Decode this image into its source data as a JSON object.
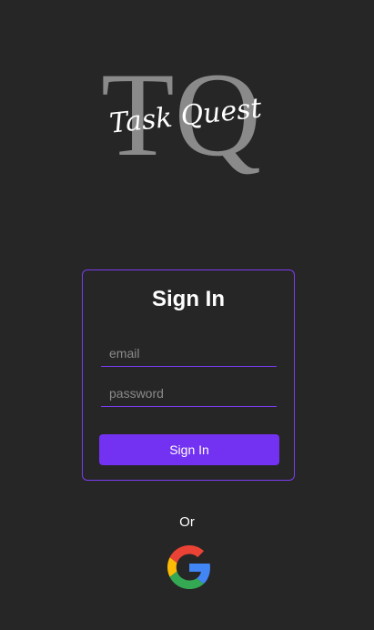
{
  "logo": {
    "monogram": "TQ",
    "script_text": "Task Quest"
  },
  "signin_card": {
    "title": "Sign In",
    "email_placeholder": "email",
    "password_placeholder": "password",
    "submit_label": "Sign In"
  },
  "alt_login": {
    "divider_text": "Or",
    "google_icon": "google-icon"
  },
  "colors": {
    "background": "#262626",
    "accent": "#7331f2",
    "border_accent": "#7a3cf0",
    "logo_gray": "#8a8a8a"
  }
}
